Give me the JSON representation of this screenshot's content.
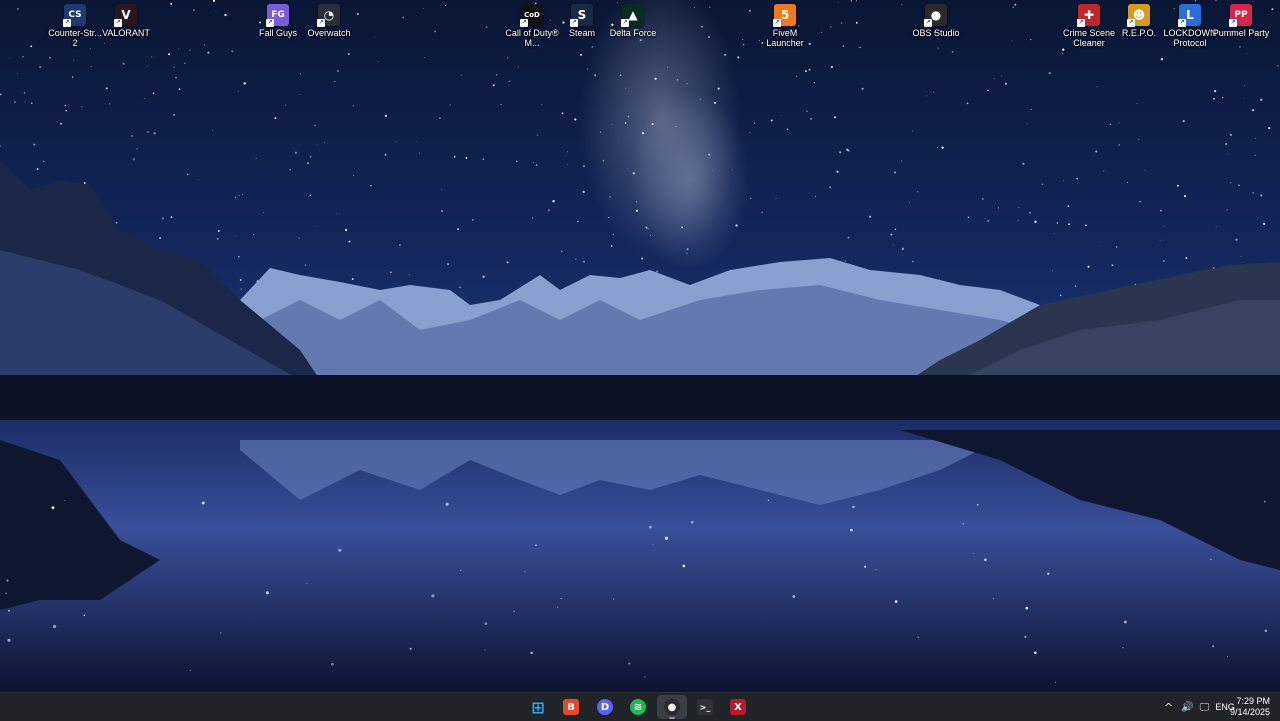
{
  "desktop": {
    "icons": [
      {
        "label": "Counter-Str... 2",
        "icon": "counter-strike-icon",
        "color": "#1d3a73",
        "glyph": "CS"
      },
      {
        "label": "VALORANT",
        "icon": "valorant-icon",
        "color": "#2b1620",
        "glyph": "V"
      },
      {
        "label": "Fall Guys",
        "icon": "fall-guys-icon",
        "color": "#7a5bd8",
        "glyph": "FG"
      },
      {
        "label": "Overwatch",
        "icon": "overwatch-icon",
        "color": "#2a2e36",
        "glyph": "◔"
      },
      {
        "label": "Call of Duty® M...",
        "icon": "call-of-duty-icon",
        "color": "#111111",
        "glyph": "CoD"
      },
      {
        "label": "Steam",
        "icon": "steam-icon",
        "color": "#1b2a44",
        "glyph": "S"
      },
      {
        "label": "Delta Force",
        "icon": "delta-force-icon",
        "color": "#0b2a22",
        "glyph": "▲"
      },
      {
        "label": "FiveM Launcher",
        "icon": "fivem-icon",
        "color": "#f07a1a",
        "glyph": "5"
      },
      {
        "label": "OBS Studio",
        "icon": "obs-icon",
        "color": "#2a2a2a",
        "glyph": "●"
      },
      {
        "label": "Crime Scene Cleaner",
        "icon": "crime-scene-cleaner-icon",
        "color": "#c0262a",
        "glyph": "✚"
      },
      {
        "label": "R.E.P.O.",
        "icon": "repo-icon",
        "color": "#d89a1f",
        "glyph": "☻"
      },
      {
        "label": "LOCKDOWN Protocol",
        "icon": "lockdown-protocol-icon",
        "color": "#2a6ed6",
        "glyph": "L"
      },
      {
        "label": "Pummel Party",
        "icon": "pummel-party-icon",
        "color": "#d8244a",
        "glyph": "PP"
      }
    ]
  },
  "taskbar": {
    "apps": [
      {
        "name": "start-button",
        "icon": "windows-icon",
        "color": "#3aa0f0",
        "glyph": "⊞",
        "active": false
      },
      {
        "name": "taskbar-brave",
        "icon": "brave-icon",
        "color": "#e8462a",
        "glyph": "B",
        "active": false
      },
      {
        "name": "taskbar-discord",
        "icon": "discord-icon",
        "color": "#5865f2",
        "glyph": "D",
        "active": false
      },
      {
        "name": "taskbar-spotify",
        "icon": "spotify-icon",
        "color": "#1db954",
        "glyph": "≋",
        "active": false
      },
      {
        "name": "taskbar-obs",
        "icon": "obs-icon",
        "color": "#2a2a2a",
        "glyph": "●",
        "active": true
      },
      {
        "name": "taskbar-terminal",
        "icon": "terminal-icon",
        "color": "#2f3338",
        "glyph": ">_",
        "active": false
      },
      {
        "name": "taskbar-app",
        "icon": "app-icon",
        "color": "#b01e2e",
        "glyph": "X",
        "active": false
      }
    ],
    "tray": {
      "chevron": "^",
      "volume": "🔊",
      "network": "🖵",
      "language": "ENG"
    },
    "clock": {
      "time": "7:29 PM",
      "date": "9/14/2025"
    }
  }
}
